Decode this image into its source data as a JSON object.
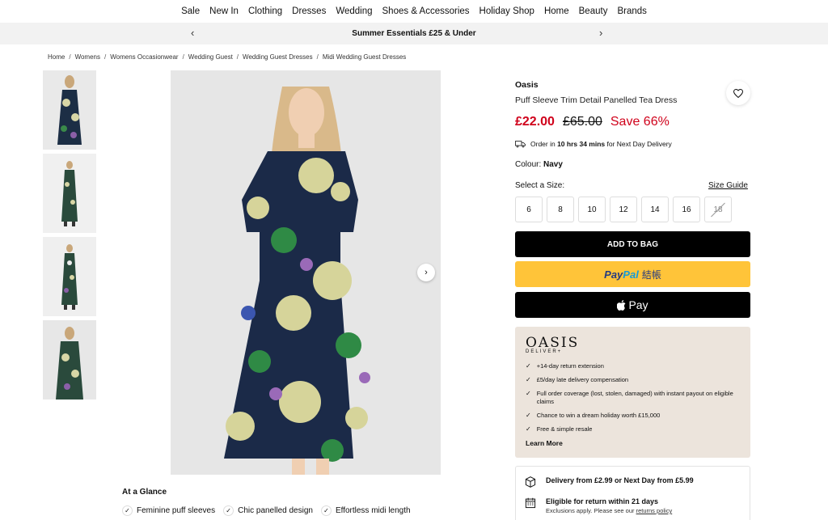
{
  "nav": {
    "items": [
      "Sale",
      "New In",
      "Clothing",
      "Dresses",
      "Wedding",
      "Shoes & Accessories",
      "Holiday Shop",
      "Home",
      "Beauty",
      "Brands"
    ]
  },
  "promo": {
    "text": "Summer Essentials £25 & Under",
    "prev": "‹",
    "next": "›"
  },
  "breadcrumb": [
    "Home",
    "Womens",
    "Womens Occasionwear",
    "Wedding Guest",
    "Wedding Guest Dresses",
    "Midi Wedding Guest Dresses"
  ],
  "product": {
    "brand": "Oasis",
    "name": "Puff Sleeve Trim Detail Panelled Tea Dress",
    "price_now": "£22.00",
    "price_was": "£65.00",
    "price_save": "Save 66%",
    "delivery": {
      "prefix": "Order in ",
      "time": "10 hrs 34 mins",
      "suffix": " for Next Day Delivery"
    },
    "colour_label": "Colour: ",
    "colour_value": "Navy",
    "size_label": "Select a Size:",
    "size_guide": "Size Guide",
    "sizes": [
      "6",
      "8",
      "10",
      "12",
      "14",
      "16",
      "18"
    ],
    "add_to_bag": "ADD TO BAG",
    "paypal": {
      "pay": "Pay",
      "pal": "Pal",
      "extra": "結帳"
    },
    "apple_pay": "Pay"
  },
  "deliver_plus": {
    "logo": "OASIS",
    "logo_sub": "DELIVER+",
    "perks": [
      "+14-day return extension",
      "£5/day late delivery compensation",
      "Full order coverage (lost, stolen, damaged) with instant payout on eligible claims",
      "Chance to win a dream holiday worth £15,000",
      "Free & simple resale"
    ],
    "learn_more": "Learn More"
  },
  "shipping": {
    "delivery": "Delivery from £2.99 or Next Day from £5.99",
    "returns": "Eligible for return within 21 days",
    "returns_note": "Exclusions apply. Please see our ",
    "returns_link": "returns policy"
  },
  "glance": {
    "title": "At a Glance",
    "items": [
      "Feminine puff sleeves",
      "Chic panelled design",
      "Effortless midi length"
    ]
  },
  "icons": [
    "heart-icon",
    "truck-icon",
    "chevron-left-icon",
    "chevron-right-icon",
    "check-icon",
    "box-icon",
    "calendar-icon",
    "apple-icon"
  ],
  "colors": {
    "sale_red": "#d0021b",
    "paypal_yellow": "#ffc439",
    "deliver_bg": "#ece4dc"
  }
}
